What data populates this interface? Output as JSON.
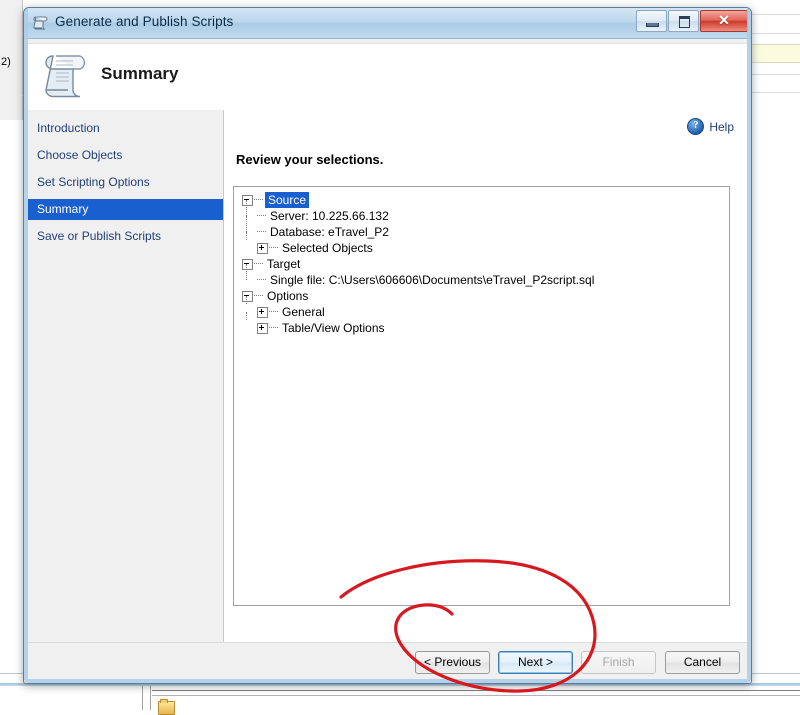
{
  "window": {
    "title": "Generate and Publish Scripts",
    "title_icon": "script-scroll-icon",
    "controls": {
      "minimize": "minimize-icon",
      "maximize": "maximize-icon",
      "close": "✕"
    }
  },
  "header": {
    "icon": "script-scroll-icon",
    "title": "Summary"
  },
  "sidebar": {
    "items": [
      {
        "label": "Introduction",
        "selected": false
      },
      {
        "label": "Choose Objects",
        "selected": false
      },
      {
        "label": "Set Scripting Options",
        "selected": false
      },
      {
        "label": "Summary",
        "selected": true
      },
      {
        "label": "Save or Publish Scripts",
        "selected": false
      }
    ]
  },
  "content": {
    "help": {
      "label": "Help",
      "icon": "help-circle-icon",
      "glyph": "?"
    },
    "heading": "Review your selections.",
    "tree": [
      {
        "level": 1,
        "toggle": "minus",
        "label": "Source",
        "selected": true
      },
      {
        "level": 2,
        "toggle": "none",
        "label": "Server: 10.225.66.132",
        "selected": false
      },
      {
        "level": 2,
        "toggle": "none",
        "label": "Database: eTravel_P2",
        "selected": false
      },
      {
        "level": 2,
        "toggle": "plus",
        "label": "Selected Objects",
        "selected": false
      },
      {
        "level": 1,
        "toggle": "minus",
        "label": "Target",
        "selected": false
      },
      {
        "level": 2,
        "toggle": "none",
        "label": "Single file: C:\\Users\\606606\\Documents\\eTravel_P2script.sql",
        "selected": false
      },
      {
        "level": 1,
        "toggle": "minus",
        "label": "Options",
        "selected": false
      },
      {
        "level": 2,
        "toggle": "plus",
        "label": "General",
        "selected": false
      },
      {
        "level": 2,
        "toggle": "plus",
        "label": "Table/View Options",
        "selected": false
      }
    ]
  },
  "buttons": {
    "previous": "< Previous",
    "next": "Next >",
    "finish": "Finish",
    "cancel": "Cancel"
  },
  "background": {
    "left_label": "2)"
  },
  "colors": {
    "selection_blue": "#1a5fd0",
    "link_blue": "#1f3f7a",
    "annotation_red": "#d8181f",
    "titlebar_blue": "#a9cbe6",
    "close_red": "#cf3b2c",
    "yellow_band": "#fbfbdf"
  }
}
